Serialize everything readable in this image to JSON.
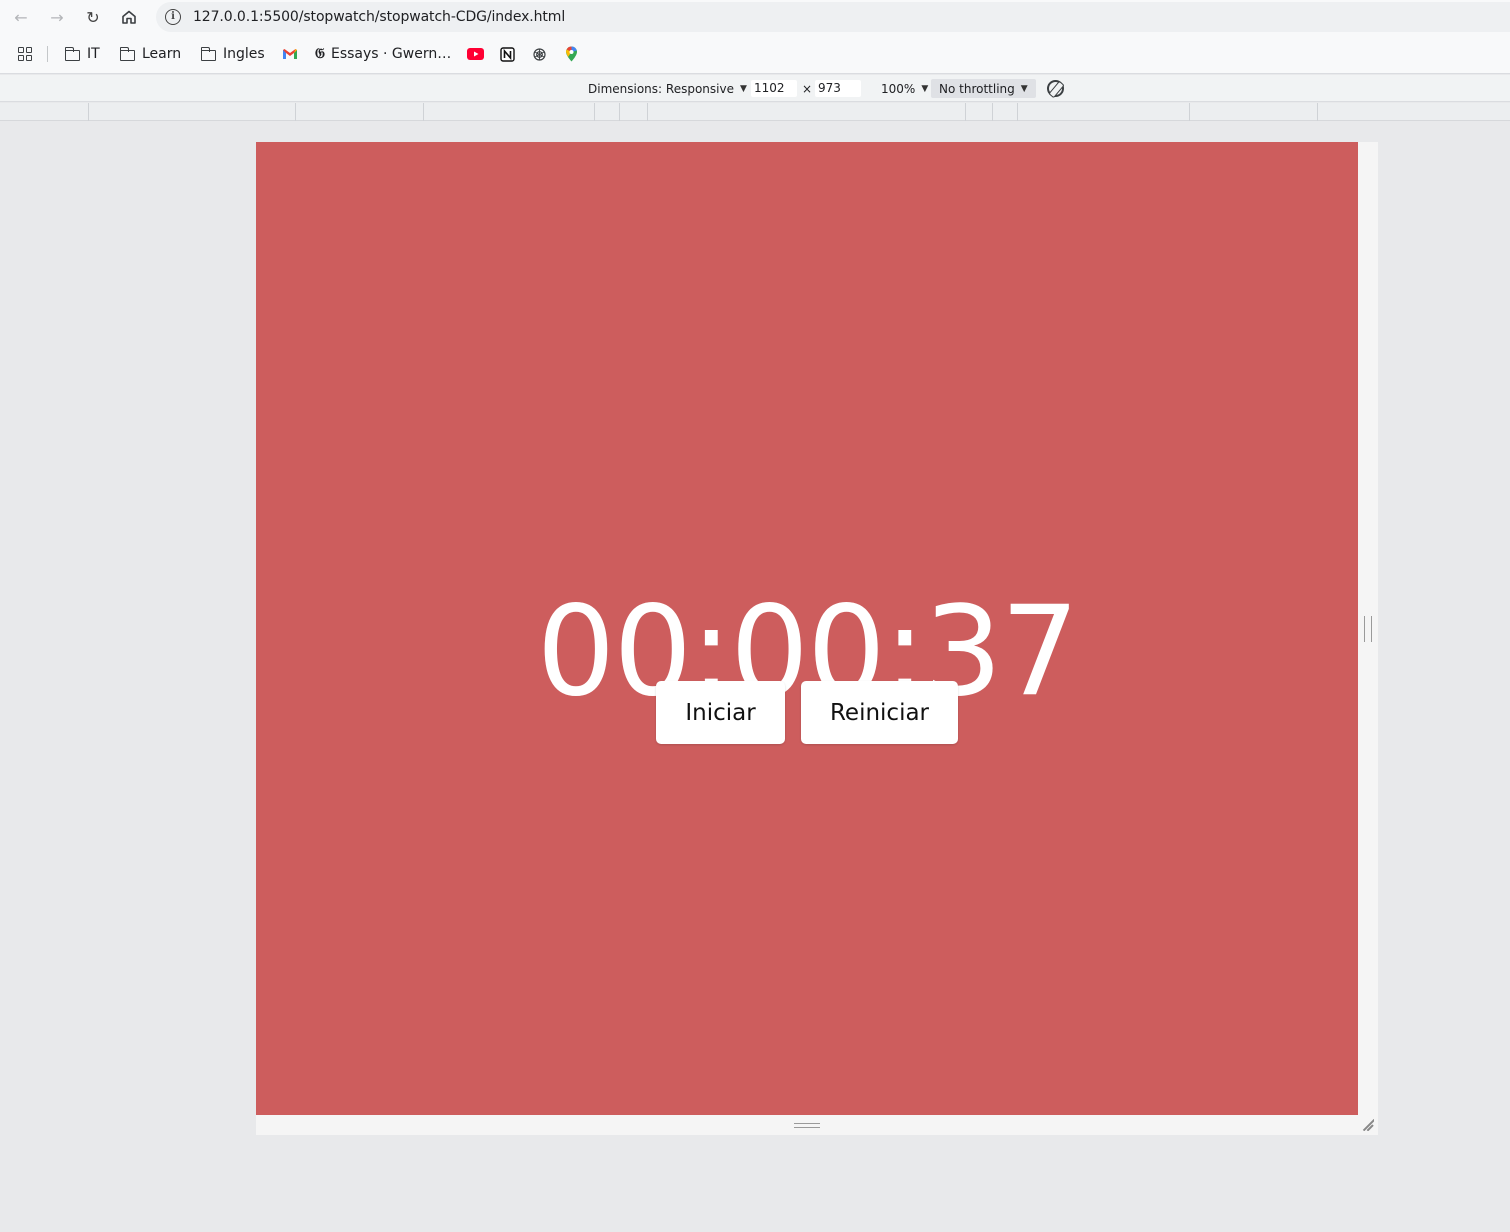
{
  "browser": {
    "url": "127.0.0.1:5500/stopwatch/stopwatch-CDG/index.html"
  },
  "bookmarks": [
    {
      "label": "IT",
      "icon": "folder-icon"
    },
    {
      "label": "Learn",
      "icon": "folder-icon"
    },
    {
      "label": "Ingles",
      "icon": "folder-icon"
    },
    {
      "label": "",
      "icon": "gmail-icon"
    },
    {
      "label": "Essays · Gwern…",
      "icon": "gwern-icon"
    },
    {
      "label": "",
      "icon": "youtube-icon"
    },
    {
      "label": "",
      "icon": "notion-icon"
    },
    {
      "label": "",
      "icon": "chatgpt-icon"
    },
    {
      "label": "",
      "icon": "maps-icon"
    }
  ],
  "devtools": {
    "dimensions_label": "Dimensions: Responsive",
    "width": "1102",
    "times": "×",
    "height": "973",
    "zoom": "100%",
    "throttling": "No throttling"
  },
  "app": {
    "time": "00:00:37",
    "start_label": "Iniciar",
    "reset_label": "Reiniciar",
    "background_color": "#cd5d5d"
  }
}
